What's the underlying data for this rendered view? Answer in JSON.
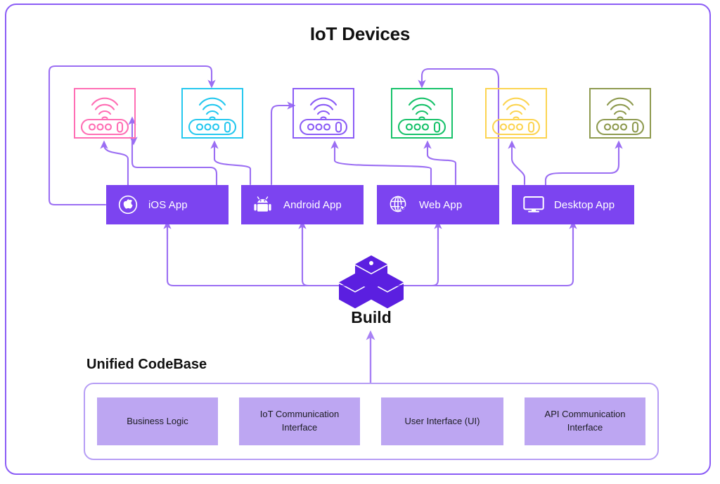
{
  "diagram": {
    "title": "IoT Devices",
    "codebase_title": "Unified CodeBase",
    "build_label": "Build",
    "frame_color": "#8b5cf6",
    "accent_color": "#7c44f0",
    "build_color": "#5b1fe0",
    "module_fill": "#bda6f2",
    "connector_color": "#9b6ef3"
  },
  "devices": [
    {
      "name": "iot-device-pink",
      "color": "#ff6eb4",
      "icon": "wifi-router-icon"
    },
    {
      "name": "iot-device-cyan",
      "color": "#25c8ef",
      "icon": "wifi-router-icon"
    },
    {
      "name": "iot-device-purple",
      "color": "#8b5cf6",
      "icon": "wifi-router-icon"
    },
    {
      "name": "iot-device-green",
      "color": "#17c26a",
      "icon": "wifi-router-icon"
    },
    {
      "name": "iot-device-yellow",
      "color": "#fcd451",
      "icon": "wifi-router-icon"
    },
    {
      "name": "iot-device-olive",
      "color": "#8e9a4f",
      "icon": "wifi-router-icon"
    }
  ],
  "apps": [
    {
      "label": "iOS App",
      "icon": "apple-icon"
    },
    {
      "label": "Android App",
      "icon": "android-icon"
    },
    {
      "label": "Web App",
      "icon": "globe-cursor-icon"
    },
    {
      "label": "Desktop App",
      "icon": "monitor-icon"
    }
  ],
  "codebase_modules": [
    {
      "label": "Business Logic"
    },
    {
      "label": "IoT Communication Interface"
    },
    {
      "label": "User Interface (UI)"
    },
    {
      "label": "API Communication Interface"
    }
  ]
}
